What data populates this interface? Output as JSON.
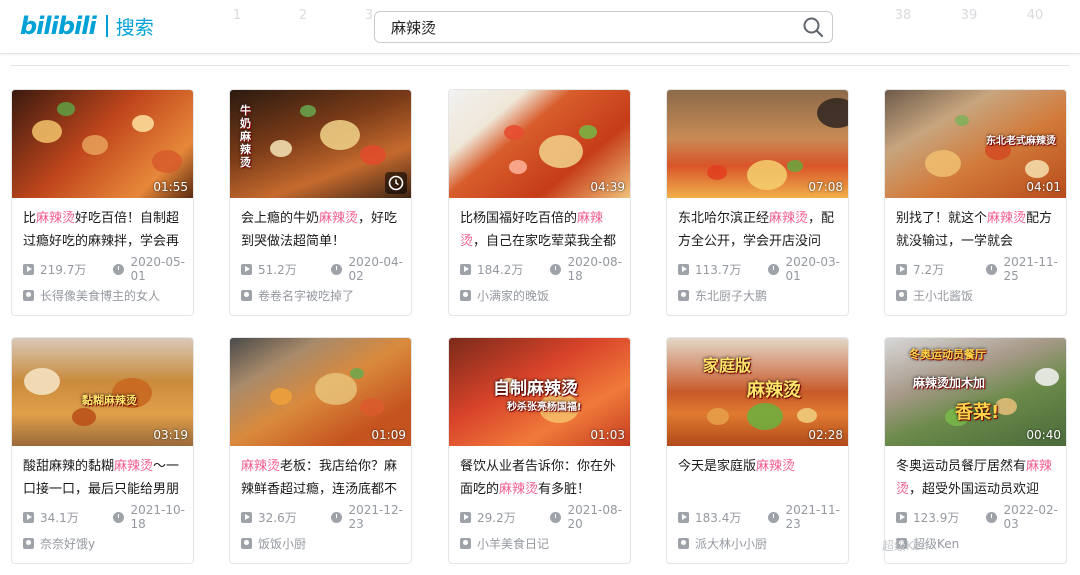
{
  "header": {
    "logo": "bilibili",
    "section": "搜索",
    "pager_left": [
      "1",
      "2",
      "3"
    ],
    "pager_right": [
      "38",
      "39",
      "40"
    ]
  },
  "search": {
    "value": "麻辣烫",
    "icon": "search-icon"
  },
  "keyword": "麻辣烫",
  "videos": [
    {
      "duration": "01:55",
      "title_pre": "比",
      "title_hl": "麻辣烫",
      "title_post": "好吃百倍！自制超过瘾好吃的麻辣拌，学会再",
      "views": "219.7万",
      "date": "2020-05-01",
      "author": "长得像美食博主的女人"
    },
    {
      "duration": "",
      "title_pre": "会上瘾的牛奶",
      "title_hl": "麻辣烫",
      "title_post": "，好吃到哭做法超简单！",
      "views": "51.2万",
      "date": "2020-04-02",
      "author": "卷卷名字被吃掉了"
    },
    {
      "duration": "04:39",
      "title_pre": "比杨国福好吃百倍的",
      "title_hl": "麻辣烫",
      "title_post": "，自己在家吃荤菜我全都",
      "views": "184.2万",
      "date": "2020-08-18",
      "author": "小满家的晚饭"
    },
    {
      "duration": "07:08",
      "title_pre": "东北哈尔滨正经",
      "title_hl": "麻辣烫",
      "title_post": "，配方全公开，学会开店没问",
      "views": "113.7万",
      "date": "2020-03-01",
      "author": "东北厨子大鹏"
    },
    {
      "duration": "04:01",
      "title_pre": "别找了！就这个",
      "title_hl": "麻辣烫",
      "title_post": "配方就没输过，一学就会",
      "views": "7.2万",
      "date": "2021-11-25",
      "author": "王小北酱饭"
    },
    {
      "duration": "03:19",
      "title_pre": "酸甜麻辣的黏糊",
      "title_hl": "麻辣烫",
      "title_post": "～一口接一口，最后只能给男朋",
      "views": "34.1万",
      "date": "2021-10-18",
      "author": "奈奈好饿y"
    },
    {
      "duration": "01:09",
      "title_pre": "",
      "title_hl": "麻辣烫",
      "title_post": "老板：我店给你？麻辣鲜香超过瘾，连汤底都不",
      "views": "32.6万",
      "date": "2021-12-23",
      "author": "饭饭小厨"
    },
    {
      "duration": "01:03",
      "title_pre": "餐饮从业者告诉你：你在外面吃的",
      "title_hl": "麻辣烫",
      "title_post": "有多脏！",
      "views": "29.2万",
      "date": "2021-08-20",
      "author": "小羊美食日记"
    },
    {
      "duration": "02:28",
      "title_pre": "今天是家庭版",
      "title_hl": "麻辣烫",
      "title_post": "",
      "views": "183.4万",
      "date": "2021-11-23",
      "author": "派大林小小厨"
    },
    {
      "duration": "00:40",
      "title_pre": "冬奥运动员餐厅居然有",
      "title_hl": "麻辣烫",
      "title_post": "，超受外国运动员欢迎",
      "views": "123.9万",
      "date": "2022-02-03",
      "author": "超级Ken"
    }
  ],
  "thumb_text": {
    "t2": "牛奶麻辣烫",
    "t5": "东北老式麻辣烫",
    "t8a": "自制麻辣烫",
    "t8b": "秒杀张亮杨国福!",
    "t9a": "家庭版",
    "t9b": "麻辣烫",
    "t10a": "冬奥运动员餐厅",
    "t10b": "麻辣烫加木加",
    "t10c": "香菜!",
    "t6": "黏糊麻辣烫"
  },
  "watermark": "超级Ken",
  "colors": {
    "brand": "#00a1d6",
    "highlight": "#f25d8e",
    "meta": "#9499a0"
  }
}
